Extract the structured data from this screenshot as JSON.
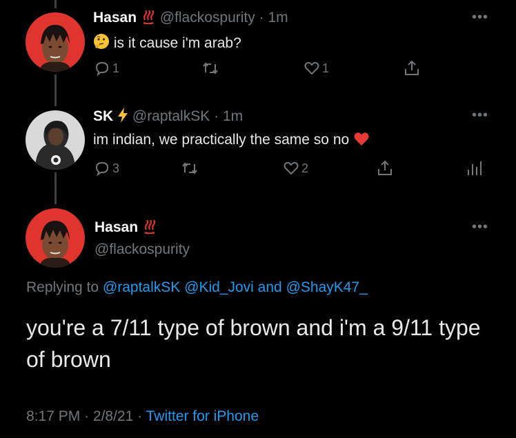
{
  "tweet1": {
    "name": "Hasan",
    "handle": "@flackospurity",
    "sep": "·",
    "time": "1m",
    "text": "is it cause i'm arab?",
    "replies": "1",
    "likes": "1",
    "avatar_icon": "person-with-braids-avatar"
  },
  "tweet2": {
    "name": "SK",
    "handle": "@raptalkSK",
    "sep": "·",
    "time": "1m",
    "text": "im indian, we practically the same so no",
    "replies": "3",
    "likes": "2",
    "avatar_icon": "person-in-hoodie-avatar"
  },
  "tweet3": {
    "name": "Hasan",
    "handle": "@flackospurity",
    "replying_prefix": "Replying to",
    "mention1": "@raptalkSK",
    "mention2": "@Kid_Jovi",
    "and": "and",
    "mention3": "@ShayK47_",
    "text": "you're a 7/11 type of brown and i'm a 9/11 type of brown",
    "time": "8:17 PM",
    "sep": "·",
    "date": "2/8/21",
    "client": "Twitter for iPhone"
  },
  "more_glyph": "•••",
  "colors": {
    "background": "#000000",
    "text": "#e7e9ea",
    "muted": "#71767b",
    "link": "#1d9bf0",
    "avatar_bg": "#e0342e",
    "heart": "#e53935",
    "fire": "#e0342e"
  }
}
